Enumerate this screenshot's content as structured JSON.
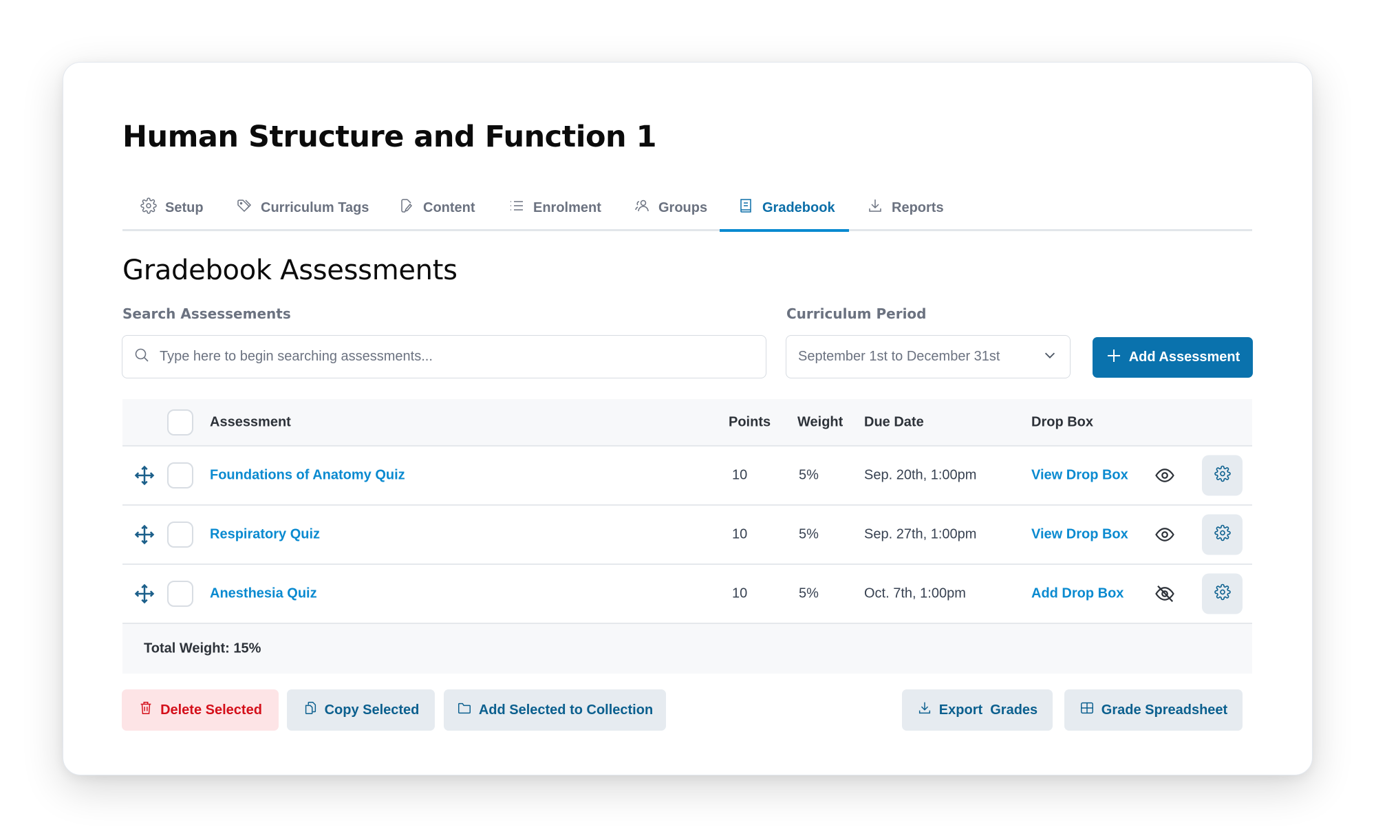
{
  "course": {
    "title": "Human Structure and Function 1"
  },
  "tabs": [
    {
      "label": "Setup",
      "icon": "gear-icon",
      "active": false
    },
    {
      "label": "Curriculum Tags",
      "icon": "tag-icon",
      "active": false
    },
    {
      "label": "Content",
      "icon": "file-edit-icon",
      "active": false
    },
    {
      "label": "Enrolment",
      "icon": "list-icon",
      "active": false
    },
    {
      "label": "Groups",
      "icon": "users-icon",
      "active": false
    },
    {
      "label": "Gradebook",
      "icon": "book-icon",
      "active": true
    },
    {
      "label": "Reports",
      "icon": "download-icon",
      "active": false
    }
  ],
  "section": {
    "title": "Gradebook Assessments"
  },
  "search": {
    "label": "Search Assessements",
    "placeholder": "Type here to begin searching assessments...",
    "value": ""
  },
  "period": {
    "label": "Curriculum Period",
    "selected": "September 1st to December 31st"
  },
  "add_assessment": {
    "label": "Add Assessment"
  },
  "table": {
    "columns": {
      "assessment": "Assessment",
      "points": "Points",
      "weight": "Weight",
      "due_date": "Due Date",
      "drop_box": "Drop Box"
    },
    "rows": [
      {
        "name": "Foundations of Anatomy Quiz",
        "points": "10",
        "weight": "5%",
        "due": "Sep. 20th, 1:00pm",
        "drop_box": "View Drop Box",
        "visible": true
      },
      {
        "name": "Respiratory Quiz",
        "points": "10",
        "weight": "5%",
        "due": "Sep. 27th, 1:00pm",
        "drop_box": "View Drop Box",
        "visible": true
      },
      {
        "name": "Anesthesia Quiz",
        "points": "10",
        "weight": "5%",
        "due": "Oct. 7th, 1:00pm",
        "drop_box": "Add Drop Box",
        "visible": false
      }
    ],
    "total": "Total Weight: 15%"
  },
  "actions": {
    "delete": "Delete Selected",
    "copy": "Copy Selected",
    "collection": "Add Selected to Collection",
    "export": "Export  Grades",
    "spreadsheet": "Grade Spreadsheet"
  },
  "colors": {
    "primary": "#0a72ad",
    "link": "#0a8ad0",
    "danger": "#d40f1a",
    "danger_bg": "#fde4e6",
    "secondary_bg": "#e6ebf0"
  }
}
